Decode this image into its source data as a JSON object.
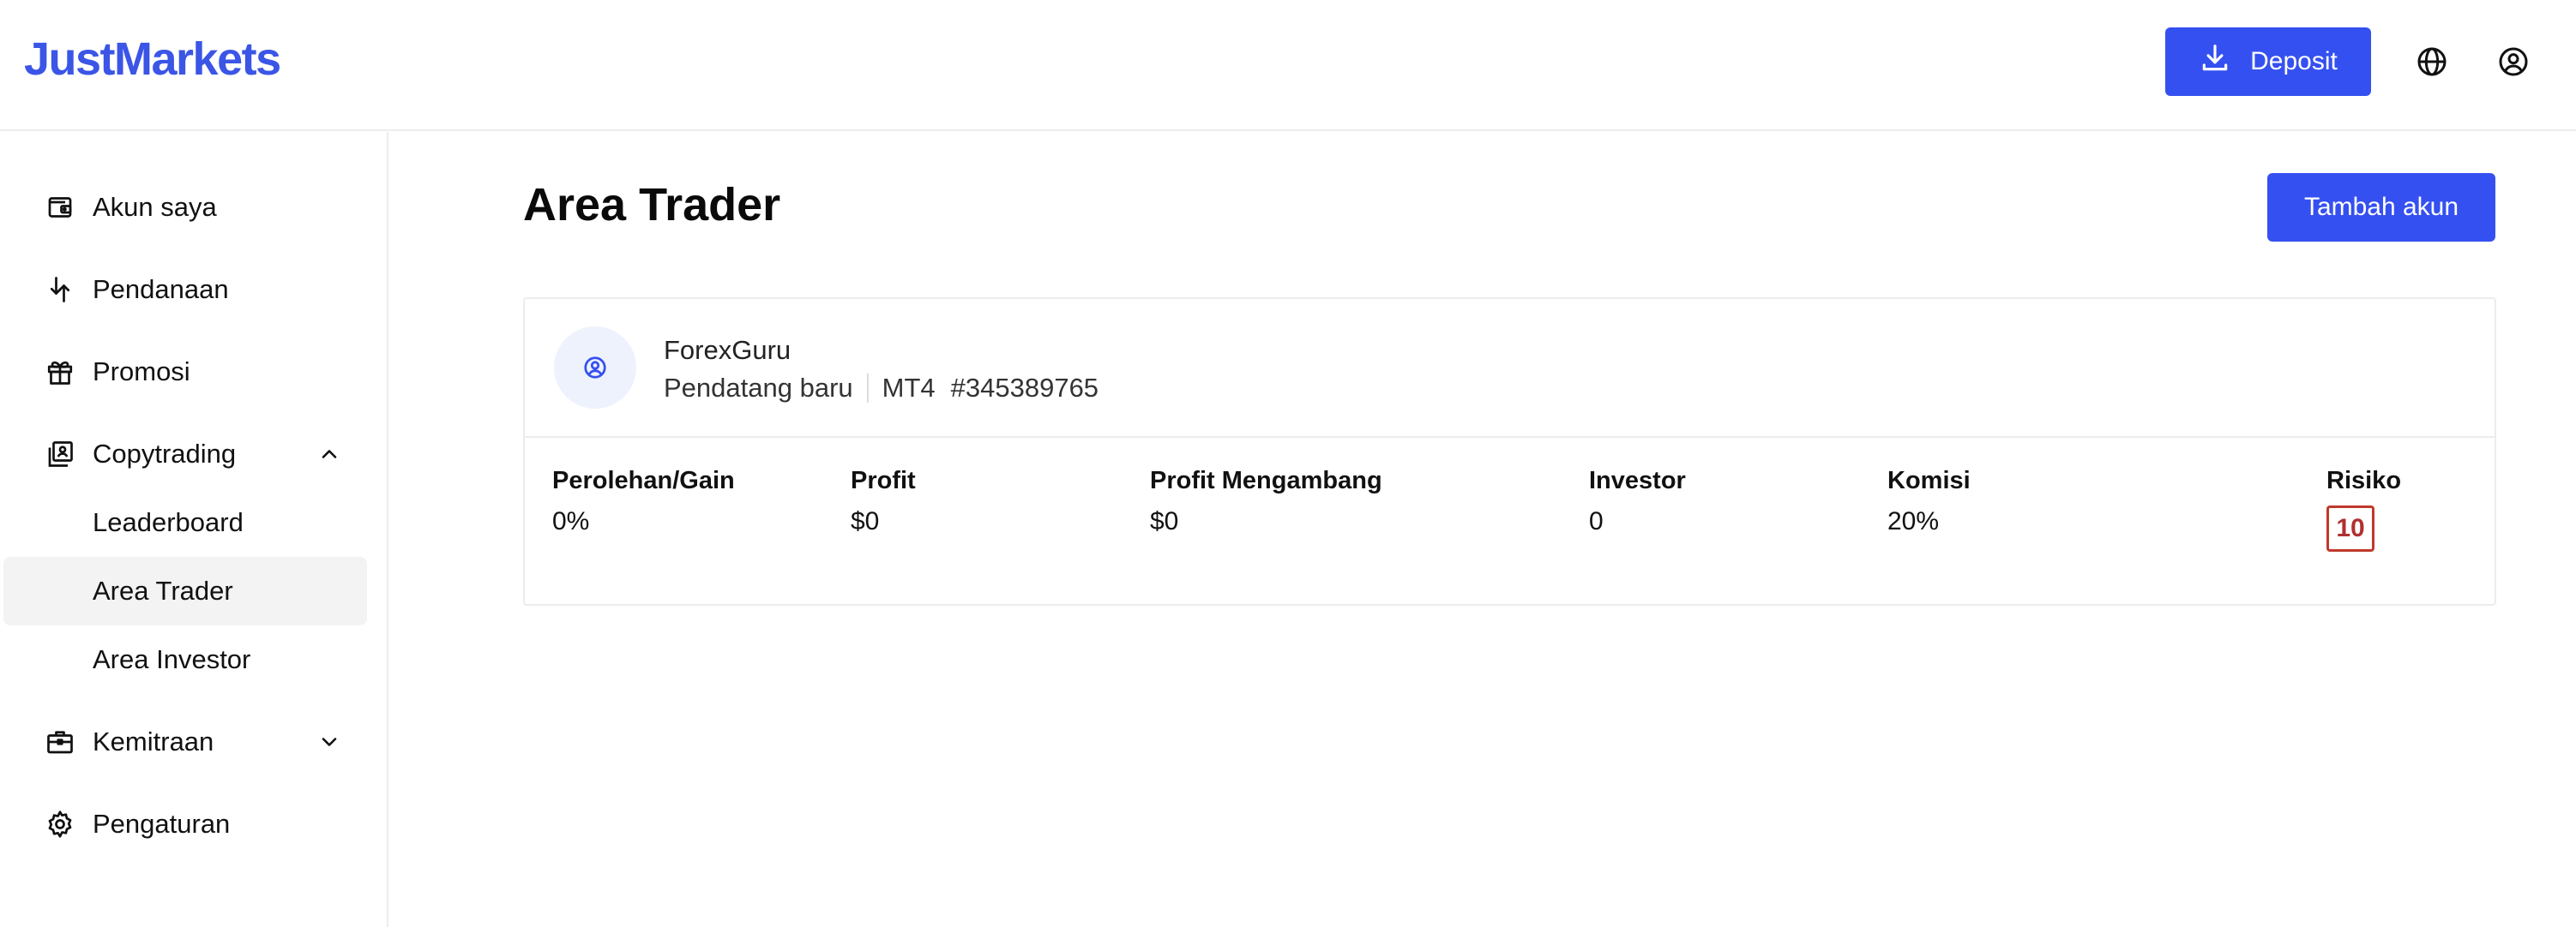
{
  "header": {
    "logo": "JustMarkets",
    "deposit_label": "Deposit",
    "icons": [
      "download-icon",
      "globe-icon",
      "user-circle-icon"
    ],
    "accent_color": "#3550f0"
  },
  "sidebar": {
    "items": [
      {
        "label": "Akun saya",
        "icon": "wallet-icon"
      },
      {
        "label": "Pendanaan",
        "icon": "transfer-arrows-icon"
      },
      {
        "label": "Promosi",
        "icon": "gift-icon"
      },
      {
        "label": "Copytrading",
        "icon": "copytrading-icon",
        "expanded": true
      },
      {
        "label": "Leaderboard",
        "sub": true
      },
      {
        "label": "Area Trader",
        "sub": true,
        "active": true
      },
      {
        "label": "Area Investor",
        "sub": true
      },
      {
        "label": "Kemitraan",
        "icon": "briefcase-icon",
        "expanded": false
      },
      {
        "label": "Pengaturan",
        "icon": "gear-icon"
      }
    ]
  },
  "main": {
    "title": "Area Trader",
    "add_account_label": "Tambah akun",
    "account": {
      "name": "ForexGuru",
      "status": "Pendatang baru",
      "platform": "MT4",
      "number": "#345389765"
    },
    "stats": [
      {
        "label": "Perolehan/Gain",
        "value": "0%"
      },
      {
        "label": "Profit",
        "value": "$0"
      },
      {
        "label": "Profit Mengambang",
        "value": "$0"
      },
      {
        "label": "Investor",
        "value": "0"
      },
      {
        "label": "Komisi",
        "value": "20%"
      },
      {
        "label": "Risiko",
        "value": "10"
      }
    ],
    "risk_color": "#c0392b"
  }
}
